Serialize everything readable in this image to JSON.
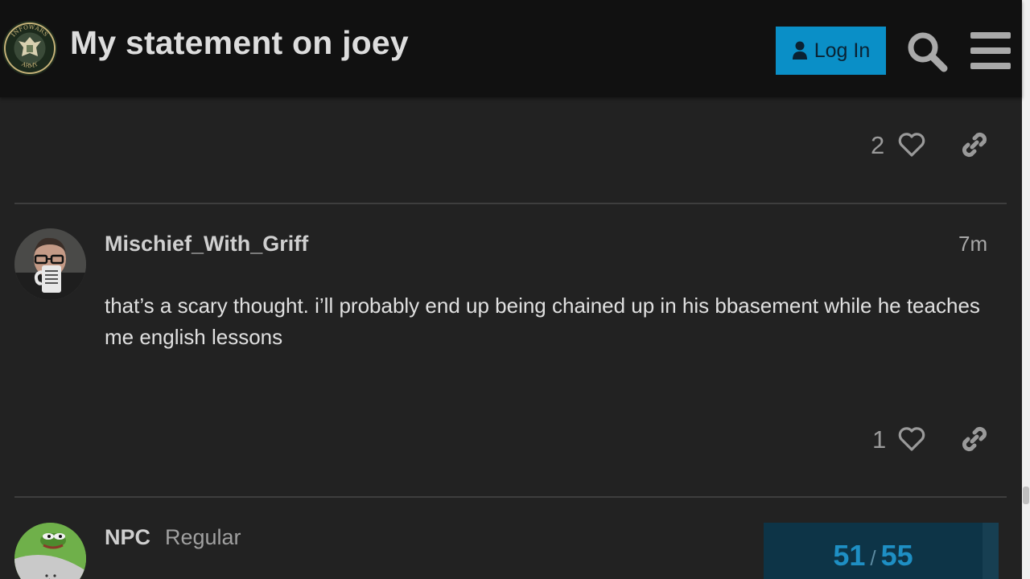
{
  "header": {
    "title": "My statement on joey",
    "login_label": "Log In",
    "logo_text_top": "INFOWARS",
    "logo_text_bottom": "ARMY"
  },
  "posts": [
    {
      "likes": "2"
    },
    {
      "username": "Mischief_With_Griff",
      "date": "7m",
      "body": "that’s a scary thought. i’ll probably end up being chained up in his bbasement while he teaches me english lessons",
      "likes": "1"
    },
    {
      "username": "NPC",
      "user_title": "Regular"
    }
  ],
  "timeline": {
    "current": "51",
    "separator": "/",
    "total": "55"
  },
  "colors": {
    "header_bg": "#111111",
    "page_bg": "#222222",
    "login_bg": "#0a8fc7",
    "progress_bg": "#0d3447",
    "progress_text": "#1e8fc4"
  },
  "icons": [
    "user-icon",
    "search-icon",
    "hamburger-menu-icon",
    "heart-icon",
    "link-icon"
  ]
}
